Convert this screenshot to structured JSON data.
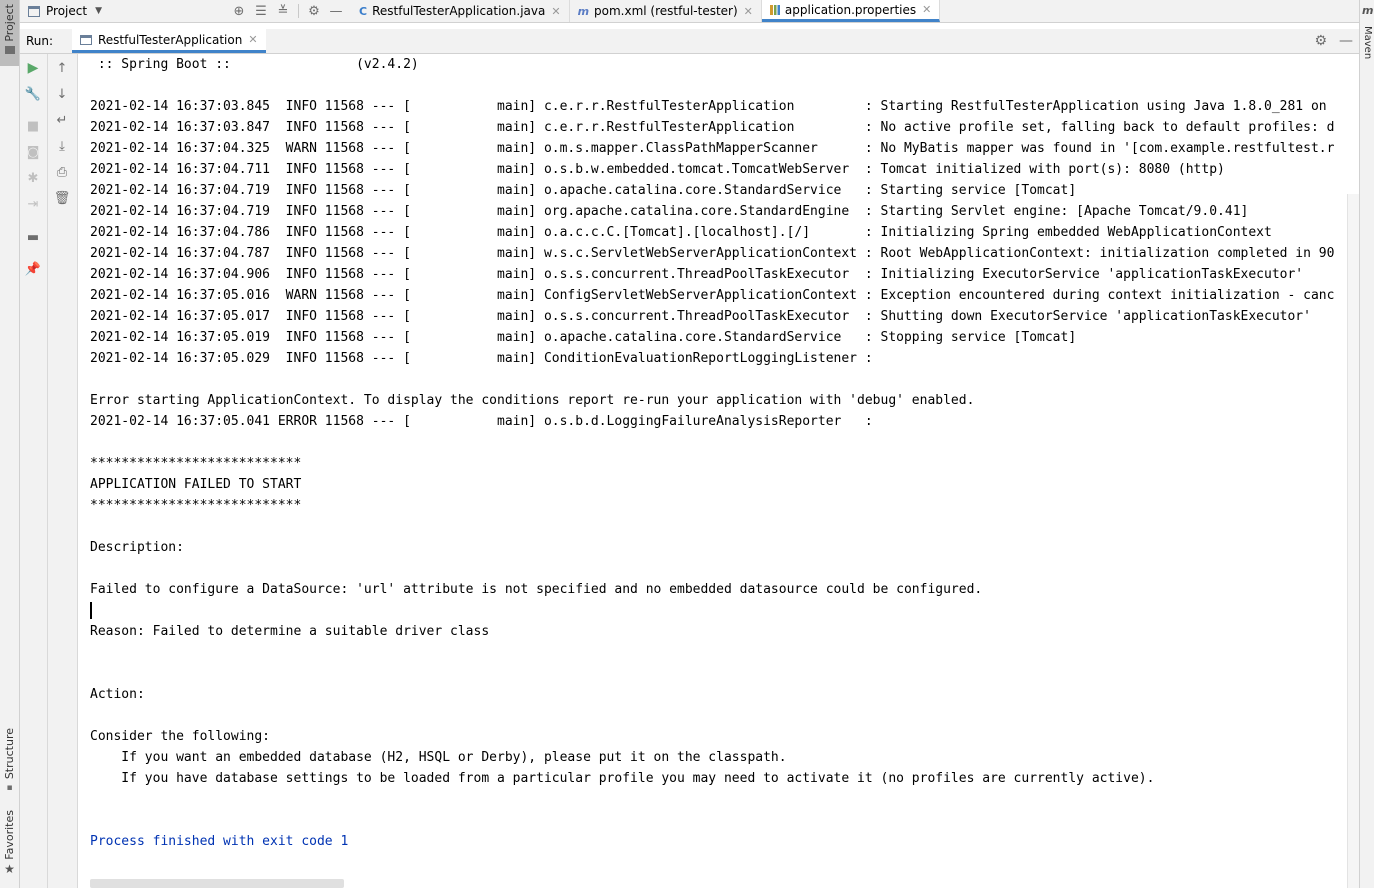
{
  "left_stripe": {
    "project_label": "Project",
    "structure_label": "Structure",
    "favorites_label": "Favorites"
  },
  "right_stripe": {
    "maven_label": "Maven"
  },
  "toolbar": {
    "project_selector": "Project",
    "tabs": [
      {
        "label": "RestfulTesterApplication.java",
        "icon": "C",
        "icon_color": "#3a7ecb"
      },
      {
        "label": "pom.xml (restful-tester)",
        "icon": "m",
        "icon_color": "#5a7cc4"
      },
      {
        "label": "application.properties",
        "icon": "chart",
        "icon_color": "#d19a2e"
      }
    ]
  },
  "run_panel": {
    "run_label": "Run:",
    "tab_label": "RestfulTesterApplication"
  },
  "console": {
    "lines": [
      " :: Spring Boot ::                (v2.4.2)",
      "",
      "2021-02-14 16:37:03.845  INFO 11568 --- [           main] c.e.r.r.RestfulTesterApplication         : Starting RestfulTesterApplication using Java 1.8.0_281 on",
      "2021-02-14 16:37:03.847  INFO 11568 --- [           main] c.e.r.r.RestfulTesterApplication         : No active profile set, falling back to default profiles: d",
      "2021-02-14 16:37:04.325  WARN 11568 --- [           main] o.m.s.mapper.ClassPathMapperScanner      : No MyBatis mapper was found in '[com.example.restfultest.r",
      "2021-02-14 16:37:04.711  INFO 11568 --- [           main] o.s.b.w.embedded.tomcat.TomcatWebServer  : Tomcat initialized with port(s): 8080 (http)",
      "2021-02-14 16:37:04.719  INFO 11568 --- [           main] o.apache.catalina.core.StandardService   : Starting service [Tomcat]",
      "2021-02-14 16:37:04.719  INFO 11568 --- [           main] org.apache.catalina.core.StandardEngine  : Starting Servlet engine: [Apache Tomcat/9.0.41]",
      "2021-02-14 16:37:04.786  INFO 11568 --- [           main] o.a.c.c.C.[Tomcat].[localhost].[/]       : Initializing Spring embedded WebApplicationContext",
      "2021-02-14 16:37:04.787  INFO 11568 --- [           main] w.s.c.ServletWebServerApplicationContext : Root WebApplicationContext: initialization completed in 90",
      "2021-02-14 16:37:04.906  INFO 11568 --- [           main] o.s.s.concurrent.ThreadPoolTaskExecutor  : Initializing ExecutorService 'applicationTaskExecutor'",
      "2021-02-14 16:37:05.016  WARN 11568 --- [           main] ConfigServletWebServerApplicationContext : Exception encountered during context initialization - canc",
      "2021-02-14 16:37:05.017  INFO 11568 --- [           main] o.s.s.concurrent.ThreadPoolTaskExecutor  : Shutting down ExecutorService 'applicationTaskExecutor'",
      "2021-02-14 16:37:05.019  INFO 11568 --- [           main] o.apache.catalina.core.StandardService   : Stopping service [Tomcat]",
      "2021-02-14 16:37:05.029  INFO 11568 --- [           main] ConditionEvaluationReportLoggingListener :",
      "",
      "Error starting ApplicationContext. To display the conditions report re-run your application with 'debug' enabled.",
      "2021-02-14 16:37:05.041 ERROR 11568 --- [           main] o.s.b.d.LoggingFailureAnalysisReporter   :",
      "",
      "***************************",
      "APPLICATION FAILED TO START",
      "***************************",
      "",
      "Description:",
      "",
      "Failed to configure a DataSource: 'url' attribute is not specified and no embedded datasource could be configured.",
      "",
      "Reason: Failed to determine a suitable driver class",
      "",
      "",
      "Action:",
      "",
      "Consider the following:",
      "    If you want an embedded database (H2, HSQL or Derby), please put it on the classpath.",
      "    If you have database settings to be loaded from a particular profile you may need to activate it (no profiles are currently active).",
      "",
      "",
      "Process finished with exit code 1"
    ],
    "exit_line_color": "#0033b3"
  },
  "colors": {
    "accent": "#4083c9",
    "run_green": "#59a869",
    "panel_bg": "#f2f2f2"
  }
}
